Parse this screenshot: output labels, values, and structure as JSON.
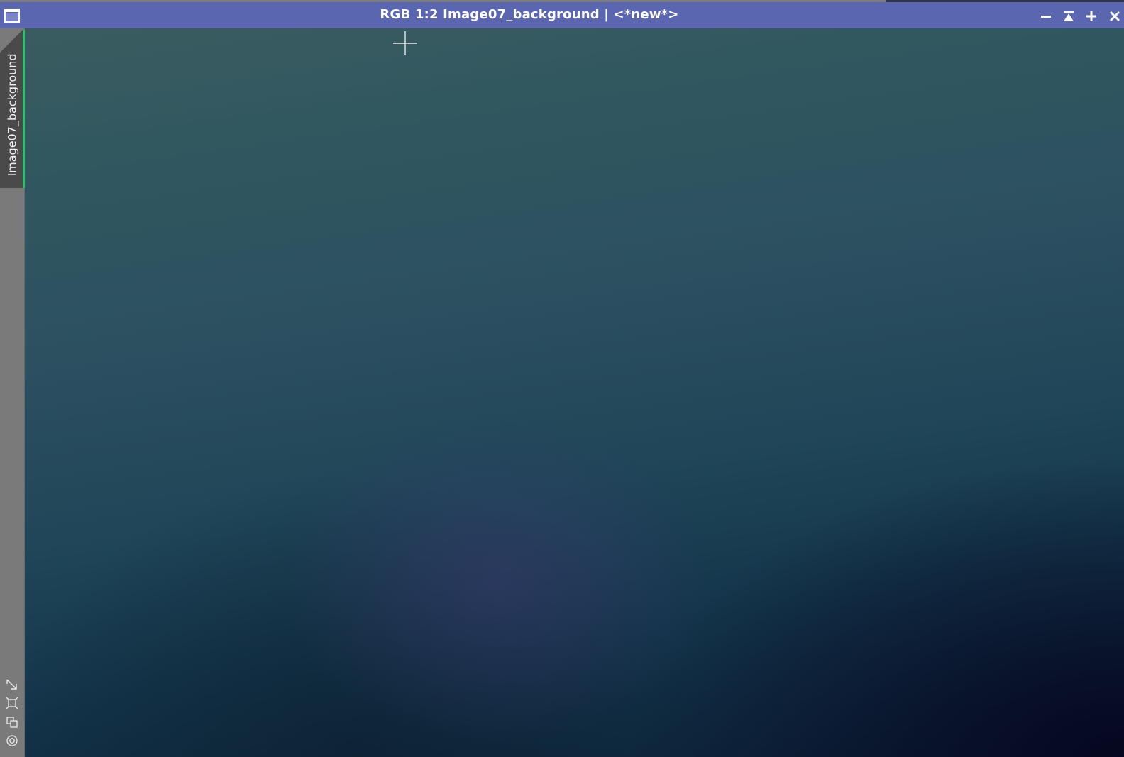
{
  "window": {
    "title": "RGB 1:2 Image07_background | <*new*>",
    "titlebar_color": "#5a66b0",
    "buttons": {
      "minimize": "minimize-icon",
      "shade": "shade-up-icon",
      "maximize": "maximize-icon",
      "close": "close-icon"
    }
  },
  "sidebar": {
    "tab_label": "Image07_background",
    "active_indicator_color": "#27c46a",
    "tools": [
      "arrow-diagonal-icon",
      "fit-view-icon",
      "clone-icon",
      "target-icon"
    ]
  },
  "image": {
    "cursor": "crosshair-icon"
  }
}
